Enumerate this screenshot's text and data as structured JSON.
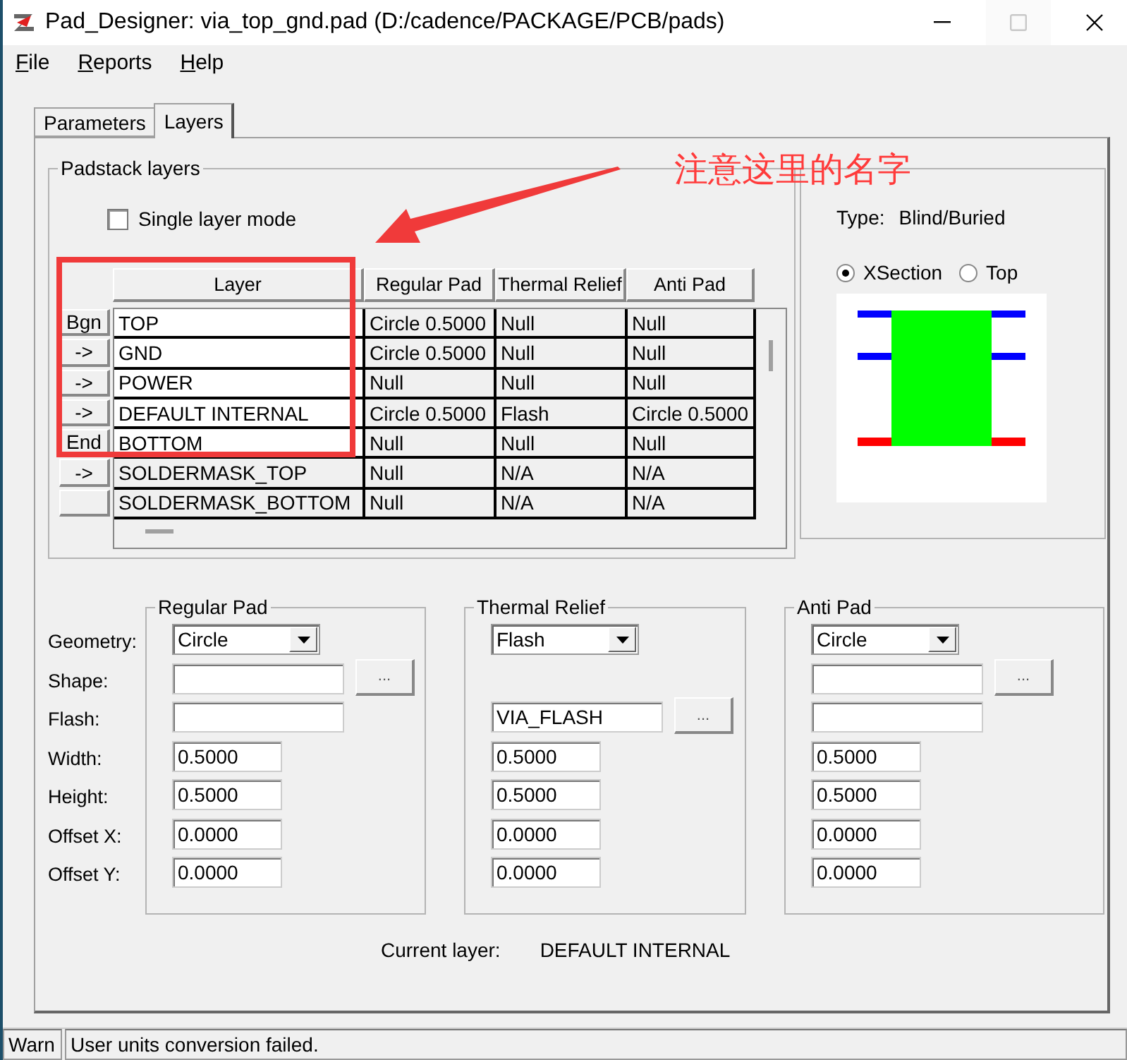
{
  "window": {
    "title": "Pad_Designer: via_top_gnd.pad (D:/cadence/PACKAGE/PCB/pads)",
    "controls": [
      {
        "kind": "minimize",
        "disabled": false
      },
      {
        "kind": "maximize",
        "disabled": true
      },
      {
        "kind": "close",
        "disabled": false
      }
    ]
  },
  "menu": [
    "File",
    "Reports",
    "Help"
  ],
  "tabs": [
    {
      "label": "Parameters",
      "selected": false
    },
    {
      "label": "Layers",
      "selected": true
    }
  ],
  "padstack_layers": {
    "title": "Padstack layers",
    "single_layer_mode": {
      "label": "Single layer mode",
      "checked": false
    },
    "columns": [
      "Layer",
      "Regular Pad",
      "Thermal Relief",
      "Anti Pad"
    ],
    "rows": [
      {
        "marker": "Bgn",
        "kind": "etch",
        "layer": "TOP",
        "regular_pad": "Circle 0.5000",
        "thermal_relief": "Null",
        "anti_pad": "Null"
      },
      {
        "marker": "->",
        "kind": "etch",
        "layer": "GND",
        "regular_pad": "Circle 0.5000",
        "thermal_relief": "Null",
        "anti_pad": "Null"
      },
      {
        "marker": "->",
        "kind": "etch",
        "layer": "POWER",
        "regular_pad": "Null",
        "thermal_relief": "Null",
        "anti_pad": "Null"
      },
      {
        "marker": "->",
        "kind": "etch",
        "layer": "DEFAULT INTERNAL",
        "regular_pad": "Circle 0.5000",
        "thermal_relief": "Flash",
        "anti_pad": "Circle 0.5000"
      },
      {
        "marker": "End",
        "kind": "etch",
        "layer": "BOTTOM",
        "regular_pad": "Null",
        "thermal_relief": "Null",
        "anti_pad": "Null"
      },
      {
        "marker": "->",
        "kind": "mask",
        "layer": "SOLDERMASK_TOP",
        "regular_pad": "Null",
        "thermal_relief": "N/A",
        "anti_pad": "N/A"
      },
      {
        "kind": "mask",
        "layer": "SOLDERMASK_BOTTOM",
        "regular_pad": "Null",
        "thermal_relief": "N/A",
        "anti_pad": "N/A"
      }
    ]
  },
  "views": {
    "type_label": "Type:",
    "type": "Blind/Buried",
    "options": [
      {
        "label": "XSection",
        "selected": true
      },
      {
        "label": "Top",
        "selected": false
      }
    ]
  },
  "field_labels": [
    "Geometry:",
    "Shape:",
    "Flash:",
    "Width:",
    "Height:",
    "Offset X:",
    "Offset Y:"
  ],
  "pads": [
    {
      "title": "Regular Pad",
      "fields": [
        {
          "kind": "combo",
          "value": "Circle"
        },
        {
          "kind": "text",
          "button": "..."
        },
        {
          "kind": "text"
        },
        {
          "kind": "number",
          "value": "0.5000"
        },
        {
          "kind": "number",
          "value": "0.5000"
        },
        {
          "kind": "number",
          "value": "0.0000"
        },
        {
          "kind": "number",
          "value": "0.0000"
        }
      ]
    },
    {
      "title": "Thermal Relief",
      "fields": [
        {
          "kind": "combo",
          "value": "Flash"
        },
        {
          "kind": "blank"
        },
        {
          "kind": "text",
          "value": "VIA_FLASH",
          "button": "..."
        },
        {
          "kind": "number",
          "value": "0.5000"
        },
        {
          "kind": "number",
          "value": "0.5000"
        },
        {
          "kind": "number",
          "value": "0.0000"
        },
        {
          "kind": "number",
          "value": "0.0000"
        }
      ]
    },
    {
      "title": "Anti Pad",
      "fields": [
        {
          "kind": "combo",
          "value": "Circle"
        },
        {
          "kind": "text",
          "button": "..."
        },
        {
          "kind": "text"
        },
        {
          "kind": "number",
          "value": "0.5000"
        },
        {
          "kind": "number",
          "value": "0.5000"
        },
        {
          "kind": "number",
          "value": "0.0000"
        },
        {
          "kind": "number",
          "value": "0.0000"
        }
      ]
    }
  ],
  "current_layer": {
    "label": "Current layer:",
    "value": "DEFAULT INTERNAL"
  },
  "status_bar": {
    "level": "Warn",
    "message": "User units conversion failed."
  },
  "annotation": {
    "text": "注意这里的名字"
  }
}
